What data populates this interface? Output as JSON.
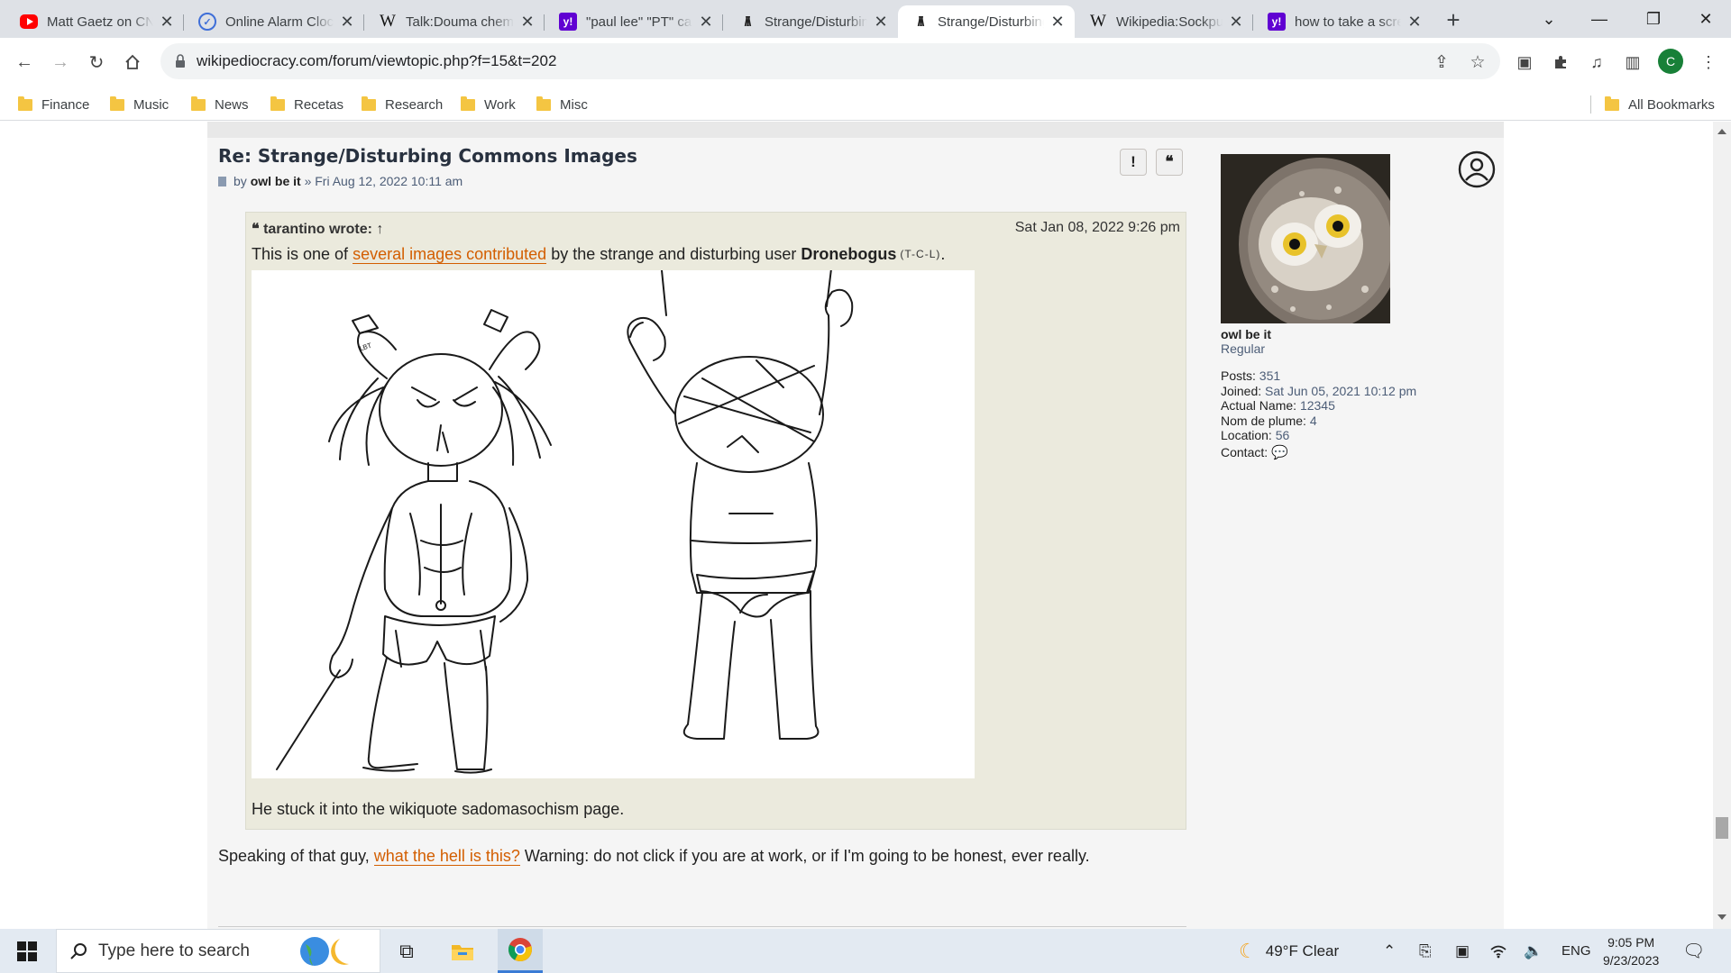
{
  "browser": {
    "tabs": [
      {
        "title": "Matt Gaetz on CNN",
        "icon": "youtube-icon"
      },
      {
        "title": "Online Alarm Clock",
        "icon": "alarm-clock-icon"
      },
      {
        "title": "Talk:Douma chemical attack",
        "icon": "wikipedia-icon"
      },
      {
        "title": "\"paul lee\" \"PT\" category",
        "icon": "yahoo-icon"
      },
      {
        "title": "Strange/Disturbing Commons",
        "icon": "wikipediocracy-icon"
      },
      {
        "title": "Strange/Disturbing Commons",
        "icon": "wikipediocracy-icon"
      },
      {
        "title": "Wikipedia:Sockpuppet investigations",
        "icon": "wikipedia-icon"
      },
      {
        "title": "how to take a screenshot",
        "icon": "yahoo-icon"
      }
    ],
    "active_tab": 5,
    "url": "wikipediocracy.com/forum/viewtopic.php?f=15&t=202",
    "profile_initial": "C",
    "bookmarks": [
      "Finance",
      "Music",
      "News",
      "Recetas",
      "Research",
      "Work",
      "Misc"
    ],
    "all_bookmarks": "All Bookmarks"
  },
  "post": {
    "title": "Re: Strange/Disturbing Commons Images",
    "by": "by",
    "author": "owl be it",
    "date": "» Fri Aug 12, 2022 10:11 am",
    "report_label": "!",
    "quote_label": "❝",
    "quote": {
      "author": "tarantino wrote:",
      "arrow": "↑",
      "date": "Sat Jan 08, 2022 9:26 pm",
      "line1_a": "This is one of ",
      "line1_link": "several images contributed",
      "line1_b": " by the strange and disturbing user ",
      "line1_user": "Dronebogus",
      "line1_sup": "(T-C-L)",
      "line1_end": ".",
      "line2_a": "He stuck it into the wikiquote ",
      "line2_link": "sadomasochism",
      "line2_b": " page."
    },
    "body_a": "Speaking of that guy, ",
    "body_link": "what the hell is this?",
    "body_b": " Warning: do not click if you are at work, or if I'm going to be honest, ever really."
  },
  "profile": {
    "username": "owl be it",
    "rank": "Regular",
    "posts_label": "Posts:",
    "posts": "351",
    "joined_label": "Joined:",
    "joined": "Sat Jun 05, 2021 10:12 pm",
    "actual_name_label": "Actual Name:",
    "actual_name": "12345",
    "nom_label": "Nom de plume:",
    "nom": "4",
    "location_label": "Location:",
    "location": "56",
    "contact_label": "Contact:"
  },
  "taskbar": {
    "search_placeholder": "Type here to search",
    "weather": "49°F  Clear",
    "lang": "ENG",
    "time": "9:05 PM",
    "date": "9/23/2023"
  },
  "colors": {
    "link": "#d35e00",
    "quote_bg": "#ebeadd",
    "tab_strip": "#dee1e6"
  }
}
